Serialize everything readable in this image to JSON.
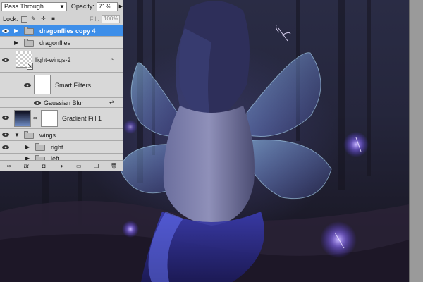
{
  "layers_panel": {
    "blend_mode": "Pass Through",
    "opacity_label": "Opacity:",
    "opacity_value": "71%",
    "lock_label": "Lock:",
    "fill_label": "Fill:",
    "fill_value": "100%",
    "layers": [
      {
        "name": "dragonflies copy 4",
        "type": "group",
        "selected": true
      },
      {
        "name": "dragonflies",
        "type": "group"
      },
      {
        "name": "light-wings-2",
        "type": "smart-object"
      },
      {
        "name": "Smart Filters",
        "type": "smart-filters"
      },
      {
        "name": "Gaussian Blur",
        "type": "filter"
      },
      {
        "name": "Gradient Fill 1",
        "type": "fill-layer"
      },
      {
        "name": "wings",
        "type": "group",
        "expanded": true
      },
      {
        "name": "right",
        "type": "group"
      },
      {
        "name": "left",
        "type": "group"
      }
    ],
    "bottom_icons": [
      "link-icon",
      "fx-icon",
      "mask-icon",
      "adjustment-icon",
      "new-group-icon",
      "new-layer-icon",
      "trash-icon"
    ]
  },
  "colors": {
    "selection": "#3d8ee9",
    "panel_bg": "#d8d8d8",
    "canvas_glow": "#8a7cff"
  }
}
